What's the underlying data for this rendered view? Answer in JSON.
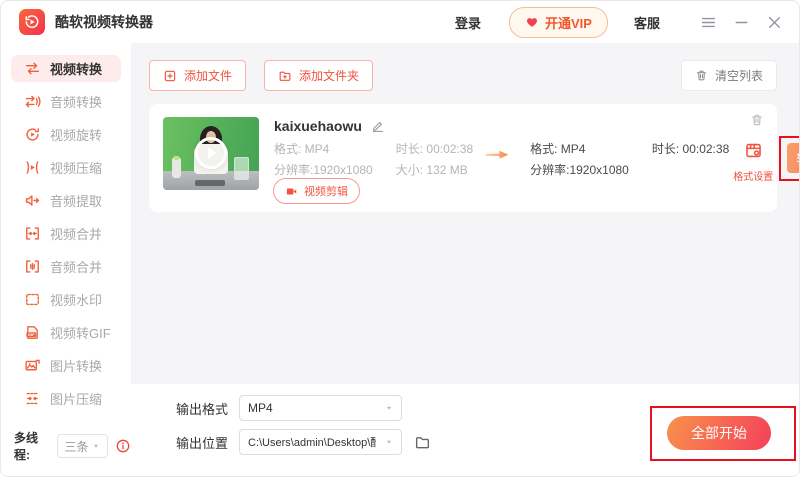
{
  "window": {
    "title": "酷软视频转换器",
    "login": "登录",
    "vip": "开通VIP",
    "support": "客服"
  },
  "sidebar": {
    "items": [
      {
        "label": "视频转换",
        "icon": "convert-video",
        "active": true
      },
      {
        "label": "音频转换",
        "icon": "convert-audio",
        "active": false
      },
      {
        "label": "视频旋转",
        "icon": "rotate-video",
        "active": false
      },
      {
        "label": "视频压缩",
        "icon": "compress-video",
        "active": false
      },
      {
        "label": "音频提取",
        "icon": "extract-audio",
        "active": false
      },
      {
        "label": "视频合并",
        "icon": "merge-video",
        "active": false
      },
      {
        "label": "音频合并",
        "icon": "merge-audio",
        "active": false
      },
      {
        "label": "视频水印",
        "icon": "watermark",
        "active": false
      },
      {
        "label": "视频转GIF",
        "icon": "gif-file",
        "active": false
      },
      {
        "label": "图片转换",
        "icon": "image-convert",
        "active": false
      },
      {
        "label": "图片压缩",
        "icon": "image-compress",
        "active": false
      }
    ],
    "thread_label": "多线程:",
    "thread_value": "三条"
  },
  "toolbar": {
    "add_file": "添加文件",
    "add_folder": "添加文件夹",
    "clear_list": "清空列表"
  },
  "file": {
    "name": "kaixuehaowu",
    "source": {
      "format": "格式: MP4",
      "duration": "时长: 00:02:38",
      "resolution": "分辨率:1920x1080",
      "size": "大小: 132 MB"
    },
    "target": {
      "format": "格式: MP4",
      "duration": "时长: 00:02:38",
      "resolution": "分辨率:1920x1080"
    },
    "clip_button": "视频剪辑",
    "format_settings": "格式设置",
    "convert_button": "转换(极速)"
  },
  "output": {
    "format_label": "输出格式",
    "format_value": "MP4",
    "location_label": "输出位置",
    "location_value": "C:\\Users\\admin\\Desktop\\酷软视频转"
  },
  "actions": {
    "start_all": "全部开始"
  },
  "icons": {
    "logo": "logo",
    "heart": "heart",
    "menu": "hamburger",
    "minimize": "minus",
    "close": "close",
    "add_file": "file-plus",
    "add_folder": "folder-plus",
    "trash": "trash",
    "edit": "pencil",
    "arrow": "flow-arrow",
    "clip": "camera",
    "settings": "settings-panel",
    "caret": "caret-down",
    "folder": "folder",
    "info": "info"
  },
  "colors": {
    "accent": "#f4513f",
    "gradient_start": "#f9924c",
    "gradient_end": "#f43f5a",
    "annotation": "#e8101e",
    "active_item_bg": "#fdeceb",
    "main_bg": "#f5f5f7"
  }
}
